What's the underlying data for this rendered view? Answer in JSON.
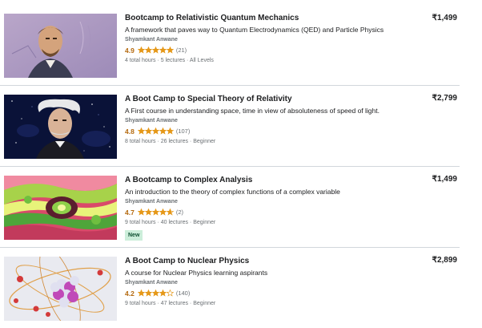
{
  "courses": [
    {
      "title": "Bootcamp to Relativistic Quantum Mechanics",
      "subtitle": "A framework that paves way to Quantum Electrodynamics (QED) and Particle Physics",
      "author": "Shyamkant Anwane",
      "rating": "4.9",
      "rating_value": 4.9,
      "review_count": "(21)",
      "meta": "4 total hours · 5 lectures · All Levels",
      "price": "₹1,499",
      "thumbnail": "portrait-painting"
    },
    {
      "title": "A Boot Camp to Special Theory of Relativity",
      "subtitle": "A First course in understanding space, time in view of absoluteness of speed of light.",
      "author": "Shyamkant Anwane",
      "rating": "4.8",
      "rating_value": 4.8,
      "review_count": "(107)",
      "meta": "8 total hours · 26 lectures · Beginner",
      "price": "₹2,799",
      "thumbnail": "portrait-starfield"
    },
    {
      "title": "A Bootcamp to Complex Analysis",
      "subtitle": "An introduction to the theory of complex functions of a complex variable",
      "author": "Shyamkant Anwane",
      "rating": "4.7",
      "rating_value": 4.7,
      "review_count": "(2)",
      "meta": "9 total hours · 40 lectures · Beginner",
      "badge": "New",
      "price": "₹1,499",
      "thumbnail": "fractal"
    },
    {
      "title": "A Boot Camp to Nuclear Physics",
      "subtitle": "A course for Nuclear Physics learning aspirants",
      "author": "Shyamkant Anwane",
      "rating": "4.2",
      "rating_value": 4.2,
      "review_count": "(140)",
      "meta": "9 total hours · 47 lectures · Beginner",
      "price": "₹2,899",
      "thumbnail": "atom-nucleus"
    }
  ],
  "colors": {
    "star": "#e59819",
    "rating_text": "#b4690e",
    "badge_bg": "#cceeda",
    "divider": "#d1d7dc"
  }
}
